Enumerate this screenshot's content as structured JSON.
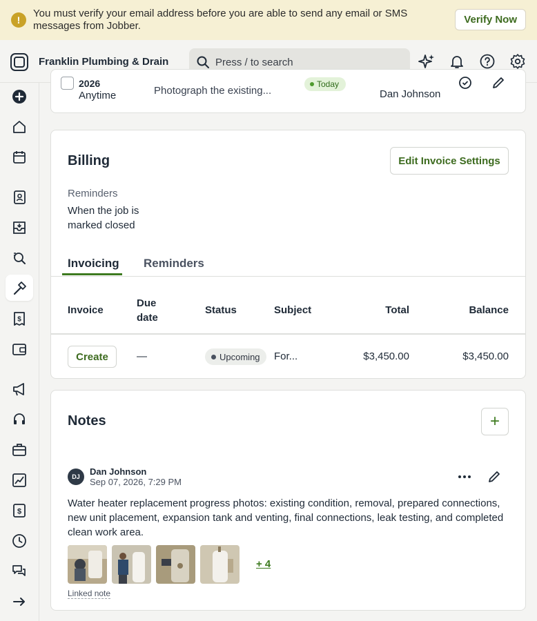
{
  "banner": {
    "message": "You must verify your email address before you are able to send any email or SMS messages from Jobber.",
    "verify_label": "Verify Now",
    "icon": "warning-icon"
  },
  "header": {
    "company": "Franklin Plumbing & Drain",
    "search_placeholder": "Press / to search",
    "icons": [
      "sparkle-icon",
      "bell-icon",
      "help-icon",
      "gear-icon"
    ]
  },
  "sidebar": {
    "items": [
      {
        "name": "create",
        "icon": "plus-circle-icon"
      },
      {
        "name": "home",
        "icon": "home-icon"
      },
      {
        "name": "schedule",
        "icon": "calendar-icon"
      },
      {
        "name": "clients",
        "icon": "contacts-icon"
      },
      {
        "name": "requests",
        "icon": "inbox-icon"
      },
      {
        "name": "quotes",
        "icon": "quote-icon"
      },
      {
        "name": "jobs",
        "icon": "hammer-icon",
        "active": true
      },
      {
        "name": "invoices",
        "icon": "invoice-icon"
      },
      {
        "name": "payments",
        "icon": "wallet-icon"
      },
      {
        "name": "marketing",
        "icon": "megaphone-icon"
      },
      {
        "name": "support",
        "icon": "headset-icon"
      },
      {
        "name": "apps",
        "icon": "briefcase-icon"
      },
      {
        "name": "reports",
        "icon": "chart-icon"
      },
      {
        "name": "expenses",
        "icon": "dollar-doc-icon"
      },
      {
        "name": "timesheets",
        "icon": "clock-icon"
      },
      {
        "name": "messages",
        "icon": "chat-icon"
      },
      {
        "name": "collapse",
        "icon": "arrow-right-icon"
      }
    ]
  },
  "visit": {
    "year": "2026",
    "time": "Anytime",
    "description": "Photograph the existing...",
    "badge": "Today",
    "assignee": "Dan Johnson"
  },
  "billing": {
    "title": "Billing",
    "edit_label": "Edit Invoice Settings",
    "reminders_label": "Reminders",
    "reminders_value": "When the job is marked closed",
    "tabs": [
      "Invoicing",
      "Reminders"
    ],
    "columns": {
      "invoice": "Invoice",
      "due_date": "Due date",
      "status": "Status",
      "subject": "Subject",
      "total": "Total",
      "balance": "Balance"
    },
    "row": {
      "create_label": "Create",
      "due_date": "—",
      "status": "Upcoming",
      "subject": "For...",
      "total": "$3,450.00",
      "balance": "$3,450.00"
    }
  },
  "notes": {
    "title": "Notes",
    "add_label": "+",
    "note": {
      "initials": "DJ",
      "author": "Dan Johnson",
      "date": "Sep 07, 2026, 7:29 PM",
      "body": "Water heater replacement progress photos: existing condition, removal, prepared connections, new unit placement, expansion tank and venting, final connections, leak testing, and completed clean work area.",
      "more_photos": "+ 4",
      "linked": "Linked note"
    }
  }
}
